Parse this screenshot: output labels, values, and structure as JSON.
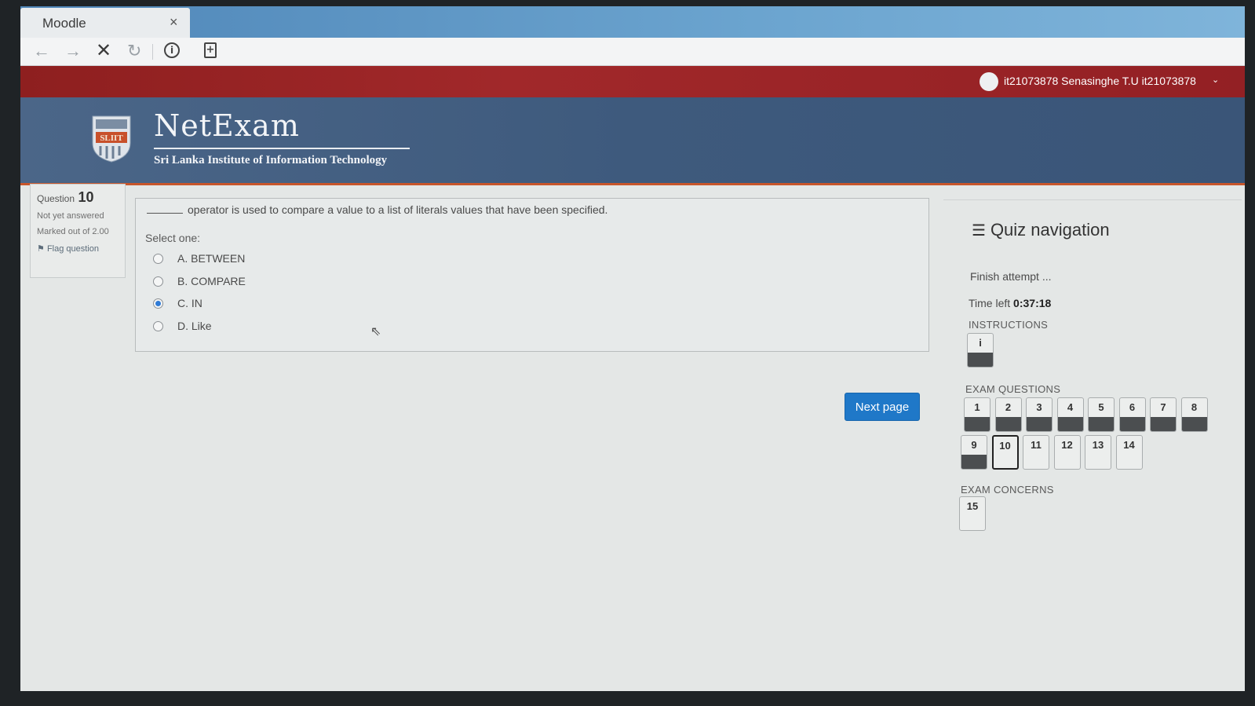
{
  "browser": {
    "tab_title": "Moodle",
    "tab_close": "×",
    "nav": {
      "back": "←",
      "forward": "→",
      "stop": "✕",
      "reload": "↻",
      "info": "i",
      "page": "+"
    }
  },
  "user": {
    "name": "it21073878 Senasinghe T.U it21073878",
    "caret": "⌄"
  },
  "brand": {
    "title": "NetExam",
    "subtitle": "Sri Lanka Institute of Information Technology",
    "logo_text": "SLIIT"
  },
  "question_info": {
    "label": "Question",
    "number": "10",
    "status": "Not yet answered",
    "marked": "Marked out of 2.00",
    "flag": "Flag question"
  },
  "question": {
    "text": "operator is used to compare a value to a list of literals values that have been specified.",
    "select_label": "Select one:",
    "options": [
      {
        "label": "A. BETWEEN",
        "checked": false
      },
      {
        "label": "B. COMPARE",
        "checked": false
      },
      {
        "label": "C. IN",
        "checked": true
      },
      {
        "label": "D. Like",
        "checked": false
      }
    ]
  },
  "next_button": "Next page",
  "quiz_nav": {
    "title": "Quiz navigation",
    "finish": "Finish attempt ...",
    "time_label": "Time left",
    "time_value": "0:37:18",
    "instructions_label": "INSTRUCTIONS",
    "instructions_button": "i",
    "exam_questions_label": "EXAM QUESTIONS",
    "questions": [
      {
        "n": "1",
        "answered": true
      },
      {
        "n": "2",
        "answered": true
      },
      {
        "n": "3",
        "answered": true
      },
      {
        "n": "4",
        "answered": true
      },
      {
        "n": "5",
        "answered": true
      },
      {
        "n": "6",
        "answered": true
      },
      {
        "n": "7",
        "answered": true
      },
      {
        "n": "8",
        "answered": true
      },
      {
        "n": "9",
        "answered": true
      },
      {
        "n": "10",
        "answered": false,
        "current": true
      },
      {
        "n": "11",
        "answered": false
      },
      {
        "n": "12",
        "answered": false
      },
      {
        "n": "13",
        "answered": false
      },
      {
        "n": "14",
        "answered": false
      }
    ],
    "exam_concerns_label": "EXAM CONCERNS",
    "concerns_button": "15"
  }
}
